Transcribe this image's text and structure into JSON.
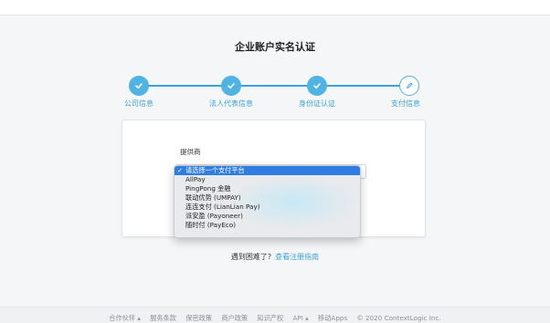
{
  "page": {
    "title": "企业账户实名认证"
  },
  "steps": [
    {
      "label": "公司信息",
      "state": "done",
      "icon": "check-icon"
    },
    {
      "label": "法人代表信息",
      "state": "done",
      "icon": "check-icon"
    },
    {
      "label": "身份证认证",
      "state": "done",
      "icon": "check-icon"
    },
    {
      "label": "支付信息",
      "state": "current",
      "icon": "pencil-icon"
    }
  ],
  "form": {
    "provider_label": "提供商",
    "select_chevron": "⌄",
    "options": [
      {
        "label": "请选择一个支付平台",
        "selected": true,
        "check": "✓"
      },
      {
        "label": "AllPay"
      },
      {
        "label": "PingPong 金融"
      },
      {
        "label": "联动优势 (UMPAY)"
      },
      {
        "label": "连连支付 (LianLian Pay)"
      },
      {
        "label": "派安盈 (Payoneer)"
      },
      {
        "label": "随时付 (PayEco)"
      }
    ]
  },
  "help": {
    "question": "遇到困难了?",
    "link": "查看注册指南"
  },
  "footer": {
    "items": [
      "合作伙伴 ▴",
      "服务条款",
      "保密政策",
      "商户政策",
      "知识产权",
      "API ▴",
      "移动Apps",
      "© 2020 ContextLogic Inc."
    ]
  },
  "colors": {
    "accent": "#3aa2d8",
    "step_fill": "#4fb3e4",
    "option_selected": "#2f7de1"
  }
}
